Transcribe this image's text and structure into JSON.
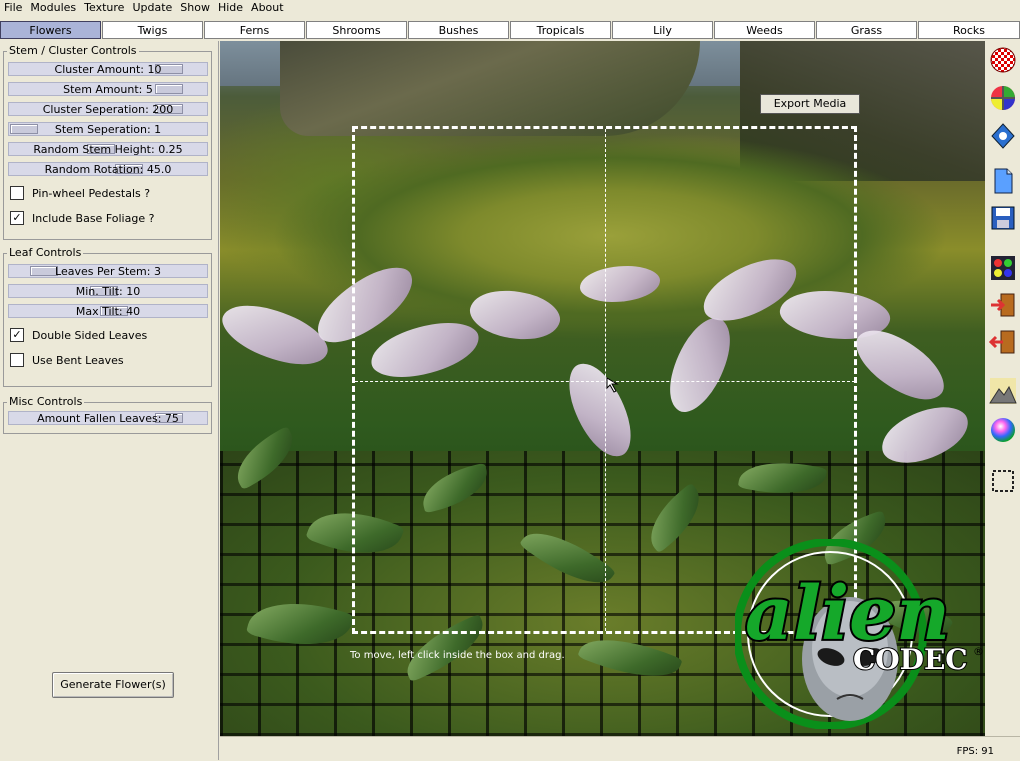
{
  "menu": [
    "File",
    "Modules",
    "Texture",
    "Update",
    "Show",
    "Hide",
    "About"
  ],
  "tabs": [
    {
      "label": "Flowers",
      "active": true
    },
    {
      "label": "Twigs",
      "active": false
    },
    {
      "label": "Ferns",
      "active": false
    },
    {
      "label": "Shrooms",
      "active": false
    },
    {
      "label": "Bushes",
      "active": false
    },
    {
      "label": "Tropicals",
      "active": false
    },
    {
      "label": "Lily",
      "active": false
    },
    {
      "label": "Weeds",
      "active": false
    },
    {
      "label": "Grass",
      "active": false
    },
    {
      "label": "Rocks",
      "active": false
    }
  ],
  "stem_cluster": {
    "title": "Stem / Cluster Controls",
    "sliders": [
      {
        "label": "Cluster Amount: 10",
        "position": 0.85
      },
      {
        "label": "Stem Amount: 5",
        "position": 0.85
      },
      {
        "label": "Cluster Seperation: 200",
        "position": 0.85
      },
      {
        "label": "Stem Seperation: 1",
        "position": 0.0
      },
      {
        "label": "Random Stem Height: 0.25",
        "position": 0.45
      },
      {
        "label": "Random Rotation: 45.0",
        "position": 0.62
      }
    ],
    "checkboxes": [
      {
        "label": "Pin-wheel Pedestals ?",
        "checked": false
      },
      {
        "label": "Include Base Foliage ?",
        "checked": true
      }
    ]
  },
  "leaf": {
    "title": "Leaf Controls",
    "sliders": [
      {
        "label": "Leaves Per Stem: 3",
        "position": 0.12
      },
      {
        "label": "Min. Tilt: 10",
        "position": 0.47
      },
      {
        "label": "Max Tilt: 40",
        "position": 0.53
      }
    ],
    "checkboxes": [
      {
        "label": "Double Sided Leaves",
        "checked": true
      },
      {
        "label": "Use Bent Leaves",
        "checked": false
      }
    ]
  },
  "misc": {
    "title": "Misc Controls",
    "sliders": [
      {
        "label": "Amount Fallen Leaves: 75",
        "position": 0.85
      }
    ]
  },
  "generate_label": "Generate Flower(s)",
  "viewport": {
    "export_label": "Export Media",
    "hint": "To move, left click inside the box and drag."
  },
  "logo": {
    "word1": "alien",
    "word2": "CODEC",
    "mark": "®"
  },
  "toolbar_icons": [
    "checker-sphere-icon",
    "color-wheel-grid-icon",
    "blue-diamond-icon",
    "new-document-icon",
    "save-disk-icon",
    "paint-palette-icon",
    "import-door-icon",
    "export-door-icon",
    "terrain-icon",
    "color-sphere-icon",
    "selection-box-icon"
  ],
  "status": {
    "fps": "FPS: 91"
  },
  "colors": {
    "active_tab": "#aab4d8",
    "slider": "#d8d9e8",
    "panel": "#ece9d8"
  }
}
